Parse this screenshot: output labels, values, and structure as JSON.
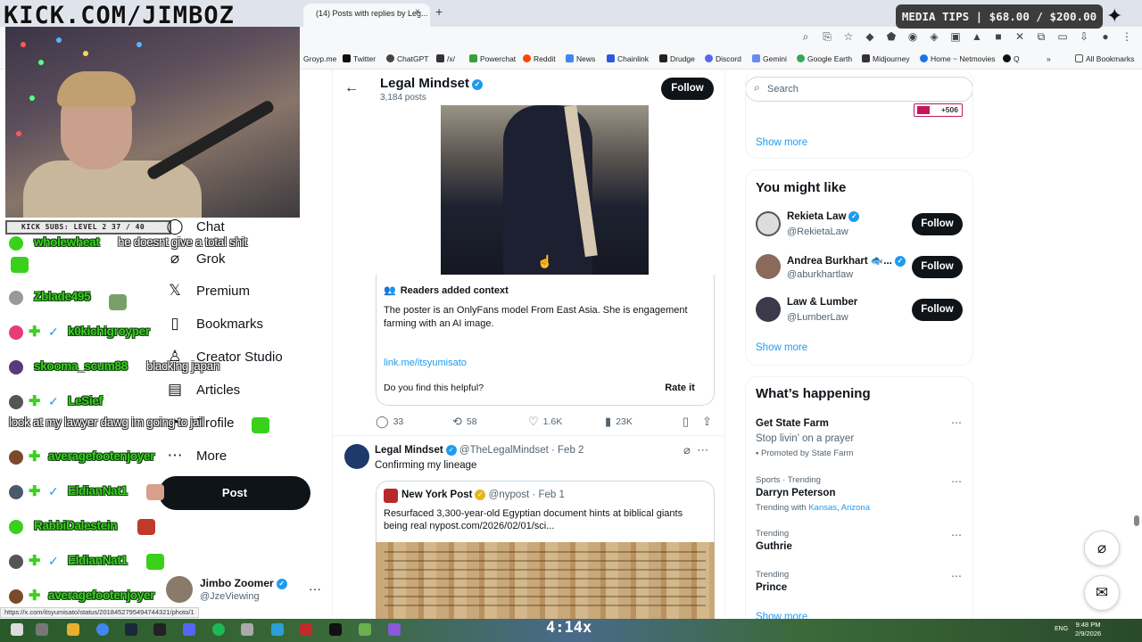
{
  "browser": {
    "tab_title": "(14) Posts with replies by Leg...",
    "tab_close": "×",
    "new_tab": "+",
    "bookmarks": [
      "Groyp.me",
      "Twitter",
      "ChatGPT",
      "/x/",
      "Powerchat",
      "Reddit",
      "News",
      "Chainlink",
      "Drudge",
      "Discord",
      "Gemini",
      "Google Earth",
      "Midjourney",
      "Home ~ Netmovies",
      "Q"
    ],
    "all_bookmarks": "All Bookmarks",
    "status_url": "https://x.com/itsyumisato/status/2018452795494744321/photo/1"
  },
  "stream": {
    "kick_logo": "KICK.COM/JIMBOZ",
    "subs_bar": "KICK SUBS: LEVEL 2 37 / 40",
    "media_tips": "MEDIA TIPS | $68.00 / $200.00",
    "taskbar_counter": "4:14x",
    "chat": [
      {
        "user": "wholewheat",
        "msg": "he doesnt give a total shit"
      },
      {
        "user": "Zblade495",
        "msg": ""
      },
      {
        "user": "k0kichigroyper",
        "msg": ""
      },
      {
        "user": "skooma_scum88",
        "msg": "blacking japan"
      },
      {
        "user": "LeSief",
        "msg": ""
      },
      {
        "user": "",
        "msg": "look at my lawyer dawg im going to jail"
      },
      {
        "user": "averagefootenjoyer",
        "msg": ""
      },
      {
        "user": "EldianNat1",
        "msg": ""
      },
      {
        "user": "RabbiDalestein",
        "msg": ""
      },
      {
        "user": "EldianNat1",
        "msg": ""
      },
      {
        "user": "averagefootenjoyer",
        "msg": ""
      }
    ]
  },
  "nav": {
    "items": [
      {
        "label": "Chat",
        "icon": "chat-icon"
      },
      {
        "label": "Grok",
        "icon": "grok-icon"
      },
      {
        "label": "Premium",
        "icon": "x-logo-icon"
      },
      {
        "label": "Bookmarks",
        "icon": "bookmark-icon"
      },
      {
        "label": "Creator Studio",
        "icon": "creator-studio-icon"
      },
      {
        "label": "Articles",
        "icon": "articles-icon"
      },
      {
        "label": "Profile",
        "icon": "profile-icon"
      },
      {
        "label": "More",
        "icon": "more-icon"
      }
    ],
    "post_label": "Post",
    "account": {
      "name": "Jimbo Zoomer",
      "handle": "@JzeViewing",
      "more": "···"
    }
  },
  "profile_header": {
    "back": "←",
    "name": "Legal Mindset",
    "posts": "3,184 posts",
    "follow": "Follow"
  },
  "tweet1": {
    "note": {
      "title": "Readers added context",
      "text": "The poster is an OnlyFans model From East Asia. She is engagement farming with an AI image.",
      "link": "link.me/itsyumisato",
      "question": "Do you find this helpful?",
      "rate": "Rate it"
    },
    "actions": {
      "replies": "33",
      "reposts": "58",
      "likes": "1.6K",
      "views": "23K"
    }
  },
  "tweet2": {
    "name": "Legal Mindset",
    "handle": "@TheLegalMindset",
    "date": "· Feb 2",
    "text": "Confirming my lineage",
    "quote": {
      "name": "New York Post",
      "handle": "@nypost",
      "date": "· Feb 1",
      "text": "Resurfaced 3,300-year-old Egyptian document hints at biblical giants being real nypost.com/2026/02/01/sci..."
    }
  },
  "sidebar": {
    "search_placeholder": "Search",
    "badge_text": "+506",
    "show_more": "Show more",
    "you_might_like": "You might like",
    "suggestions": [
      {
        "name": "Rekieta Law",
        "handle": "@RekietaLaw",
        "follow": "Follow"
      },
      {
        "name": "Andrea Burkhart 🐟...",
        "handle": "@aburkhartlaw",
        "follow": "Follow"
      },
      {
        "name": "Law & Lumber",
        "handle": "@LumberLaw",
        "follow": "Follow"
      }
    ],
    "whats_happening": "What’s happening",
    "trends": [
      {
        "meta": "",
        "name": "Get State Farm",
        "sub": "Stop livin’ on a prayer",
        "promo": "Promoted by State Farm"
      },
      {
        "meta": "Sports · Trending",
        "name": "Darryn Peterson",
        "sub_prefix": "Trending with",
        "links": [
          "Kansas",
          "Arizona"
        ]
      },
      {
        "meta": "Trending",
        "name": "Guthrie"
      },
      {
        "meta": "Trending",
        "name": "Prince"
      }
    ],
    "show_more_bottom": "Show more"
  },
  "taskbar": {
    "lang": "ENG",
    "time": "9:48 PM",
    "date": "2/9/2026"
  },
  "colors": {
    "accent": "#1d9bf0",
    "kick_green": "#39d11c",
    "text": "#0f1419"
  }
}
